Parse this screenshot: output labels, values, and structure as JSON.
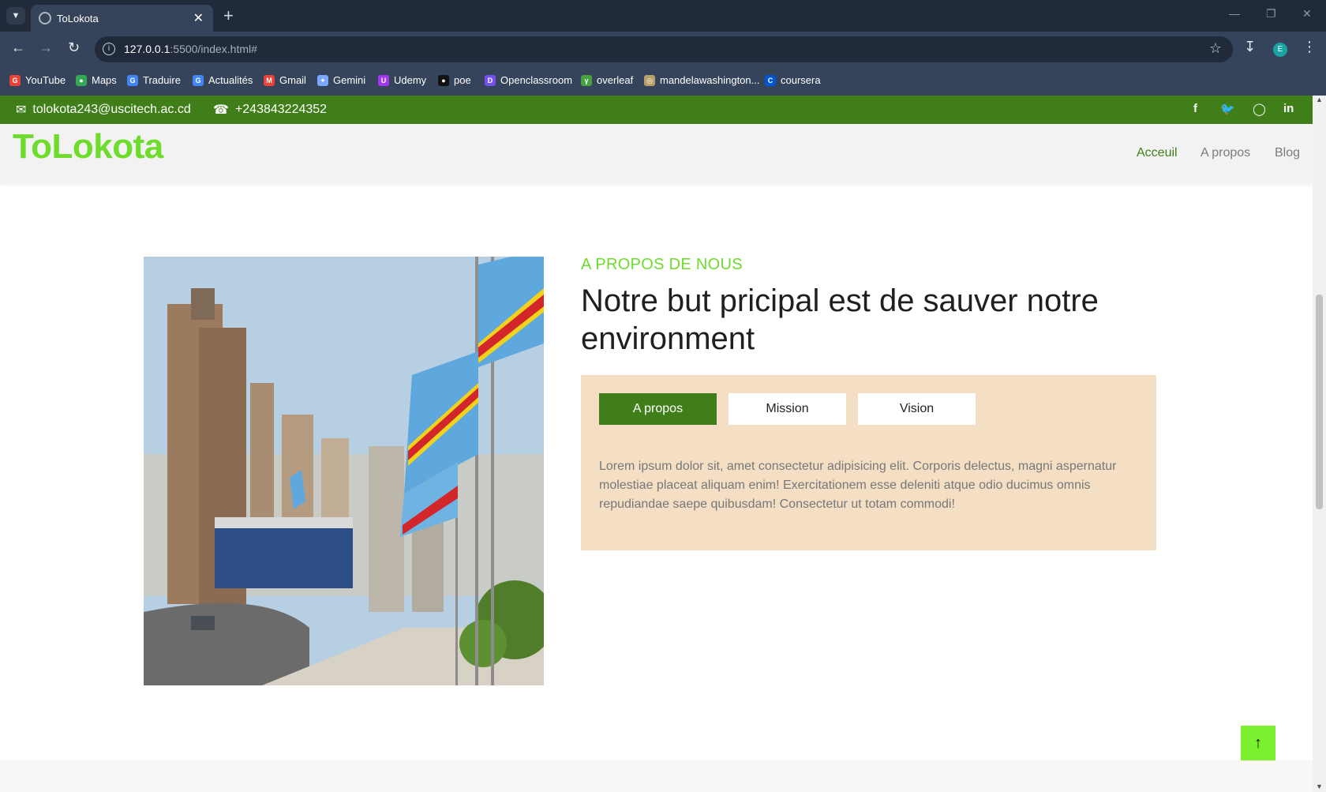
{
  "browser": {
    "tab_title": "ToLokota",
    "url_host": "127.0.0.1",
    "url_rest": ":5500/index.html#",
    "profile_initial": "E",
    "bookmarks": [
      {
        "label": "YouTube",
        "icon": "google-icon",
        "color": "#ea4335"
      },
      {
        "label": "Maps",
        "icon": "maps-pin-icon",
        "color": "#34a853"
      },
      {
        "label": "Traduire",
        "icon": "translate-icon",
        "color": "#4285f4"
      },
      {
        "label": "Actualités",
        "icon": "news-icon",
        "color": "#4285f4"
      },
      {
        "label": "Gmail",
        "icon": "gmail-icon",
        "color": "#ea4335"
      },
      {
        "label": "Gemini",
        "icon": "gemini-icon",
        "color": "#7aa7ff"
      },
      {
        "label": "Udemy",
        "icon": "udemy-icon",
        "color": "#a435f0"
      },
      {
        "label": "poe",
        "icon": "poe-icon",
        "color": "#111111"
      },
      {
        "label": "Openclassroom",
        "icon": "openclassroom-icon",
        "color": "#7451eb"
      },
      {
        "label": "overleaf",
        "icon": "overleaf-icon",
        "color": "#47a141"
      },
      {
        "label": "mandelawashington...",
        "icon": "seal-icon",
        "color": "#b8a06a"
      },
      {
        "label": "coursera",
        "icon": "coursera-icon",
        "color": "#0056d2"
      }
    ]
  },
  "topbar": {
    "email": "tolokota243@uscitech.ac.cd",
    "phone": "+243843224352",
    "social": [
      "facebook-icon",
      "twitter-icon",
      "instagram-icon",
      "linkedin-icon"
    ]
  },
  "nav": {
    "logo": "ToLokota",
    "links": [
      "Acceuil",
      "A propos",
      "Blog"
    ],
    "active": "Acceuil"
  },
  "about": {
    "kicker": "A PROPOS DE NOUS",
    "headline": "Notre but pricipal est de sauver notre environment",
    "tabs": [
      "A propos",
      "Mission",
      "Vision"
    ],
    "active_tab": "A propos",
    "text": "Lorem ipsum dolor sit, amet consectetur adipisicing elit. Corporis delectus, magni aspernatur molestiae placeat aliquam enim! Exercitationem esse deleniti atque odio ducimus omnis repudiandae saepe quibusdam! Consectetur ut totam commodi!"
  },
  "colors": {
    "brand_green": "#3f7e18",
    "logo_green": "#6edc2c",
    "panel_bg": "#f4dfc5",
    "to_top_bg": "#7bf02f"
  }
}
